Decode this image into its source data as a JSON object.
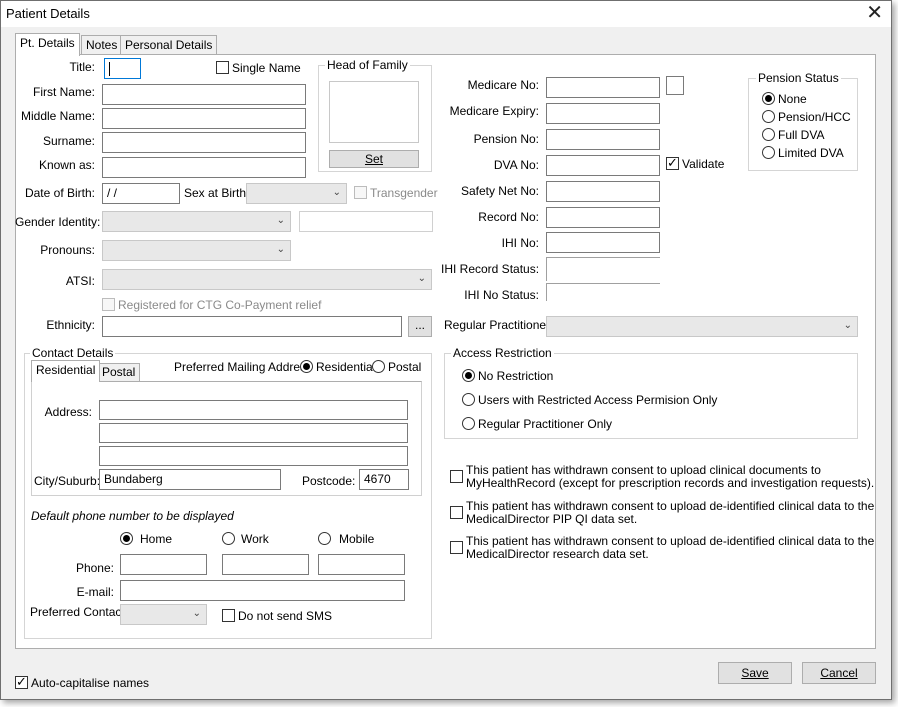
{
  "window": {
    "title": "Patient Details",
    "close": "✕"
  },
  "tabs": [
    {
      "label": "Pt. Details"
    },
    {
      "label": "Notes"
    },
    {
      "label": "Personal Details"
    }
  ],
  "form": {
    "title_label": "Title:",
    "single_name": "Single Name",
    "first_name_label": "First Name:",
    "middle_name_label": "Middle Name:",
    "surname_label": "Surname:",
    "known_as_label": "Known as:",
    "dob_label": "Date of Birth:",
    "dob_value": " /  /",
    "sex_label": "Sex at Birth:",
    "transgender": "Transgender",
    "gender_identity_label": "Gender Identity:",
    "pronouns_label": "Pronouns:",
    "atsi_label": "ATSI:",
    "ctg_label": "Registered for CTG Co-Payment relief",
    "ethnicity_label": "Ethnicity:",
    "ethnicity_btn": "...",
    "head_of_family": "Head of Family",
    "set_btn": "Set"
  },
  "medicare": {
    "medicare_no": "Medicare No:",
    "medicare_expiry": "Medicare Expiry:",
    "pension_no": "Pension No:",
    "dva_no": "DVA No:",
    "validate": "Validate",
    "safety_net": "Safety Net No:",
    "record_no": "Record No:",
    "ihi_no": "IHI No:",
    "ihi_record_status": "IHI Record Status:",
    "ihi_no_status": "IHI No Status:",
    "regular_practitioner": "Regular Practitioner:"
  },
  "pension_status": {
    "legend": "Pension Status",
    "options": [
      "None",
      "Pension/HCC",
      "Full DVA",
      "Limited DVA"
    ]
  },
  "contact": {
    "legend": "Contact Details",
    "tabs": [
      "Residential",
      "Postal"
    ],
    "preferred_mailing": "Preferred Mailing Address",
    "mail_residential": "Residential",
    "mail_postal": "Postal",
    "address_label": "Address:",
    "city_label": "City/Suburb:",
    "city_value": "Bundaberg",
    "postcode_label": "Postcode:",
    "postcode_value": "4670",
    "default_phone": "Default phone number to be displayed",
    "home": "Home",
    "work": "Work",
    "mobile": "Mobile",
    "phone_label": "Phone:",
    "email_label": "E-mail:",
    "preferred_contact_label": "Preferred Contact:",
    "no_sms": "Do not send SMS"
  },
  "access": {
    "legend": "Access Restriction",
    "options": [
      "No Restriction",
      "Users with Restricted Access Permision Only",
      "Regular Practitioner Only"
    ]
  },
  "consent": [
    {
      "line1": "This patient has withdrawn consent to upload clinical documents to",
      "line2": "MyHealthRecord (except for prescription records and investigation requests)."
    },
    {
      "line1": "This patient has withdrawn consent to upload de-identified clinical data to the",
      "line2": "MedicalDirector PIP QI data set."
    },
    {
      "line1": "This patient has withdrawn consent to upload de-identified clinical data to the",
      "line2": "MedicalDirector research data set."
    }
  ],
  "footer": {
    "auto_capitalise": "Auto-capitalise names",
    "save": "Save",
    "cancel": "Cancel"
  }
}
